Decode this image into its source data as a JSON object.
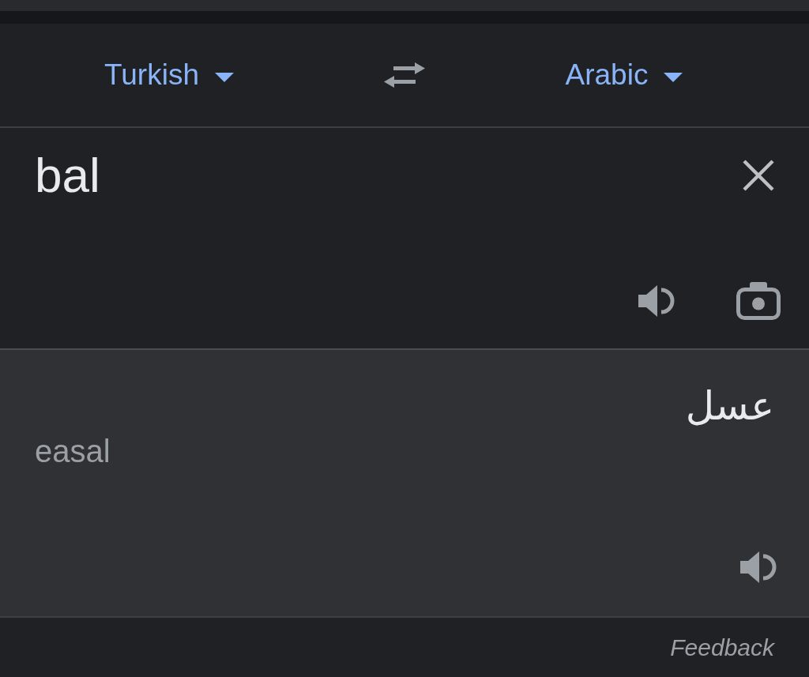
{
  "language_bar": {
    "source_language": "Turkish",
    "target_language": "Arabic"
  },
  "input": {
    "value": "bal"
  },
  "output": {
    "translation": "عسل",
    "transliteration": "easal"
  },
  "footer": {
    "link": "Feedback"
  }
}
